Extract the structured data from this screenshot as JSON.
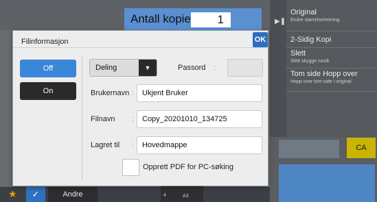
{
  "header": {
    "copies_label": "Antall kopier",
    "copies_value": "1"
  },
  "side_panel": {
    "items": [
      {
        "title": "Original",
        "subtitle": "Endre størrelse/retning."
      },
      {
        "title": "2-Sidig Kopi",
        "subtitle": ""
      },
      {
        "title": "Slett",
        "subtitle": "Slett skygge rundt"
      },
      {
        "title": "Tom side Hopp over",
        "subtitle": "Hopp over tom side i original"
      }
    ]
  },
  "right_buttons": {
    "ca_label": "CA"
  },
  "bottom_bar": {
    "other_label": "Andre",
    "sheet_count": "4",
    "paper_size": "A3"
  },
  "dialog": {
    "title": "Filinformasjon",
    "ok_label": "OK",
    "off_label": "Off",
    "on_label": "On",
    "mode_selected": "Deling",
    "password_label": "Passord",
    "username_label": "Brukernavn",
    "username_value": "Ukjent Bruker",
    "filename_label": "Filnavn",
    "filename_value": "Copy_20201010_134725",
    "saved_to_label": "Lagret til",
    "saved_to_value": "Hovedmappe",
    "pdf_search_label": "Opprett PDF for PC-søking",
    "colon": ":"
  }
}
